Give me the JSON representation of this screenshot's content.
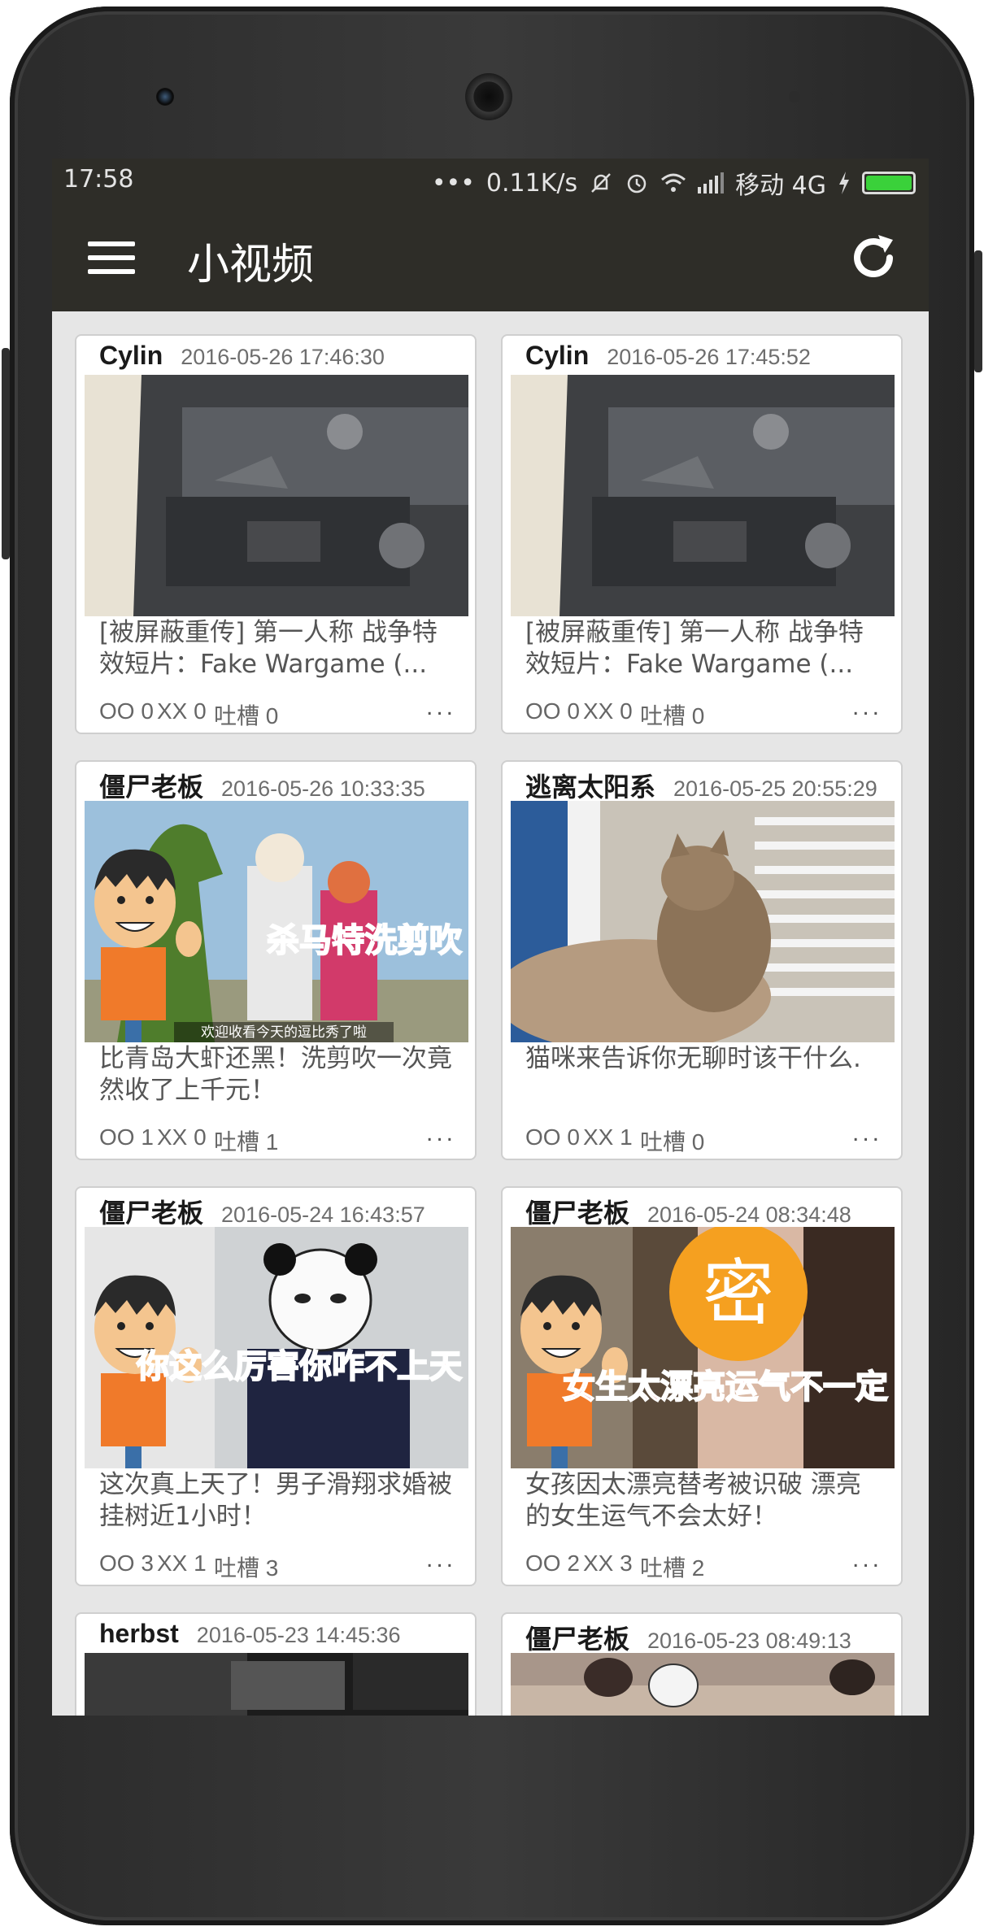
{
  "status": {
    "time": "17:58",
    "dots": "•••",
    "speed": "0.11K/s",
    "carrier": "移动 4G",
    "icons": [
      "mute-icon",
      "alarm-icon",
      "wifi-icon",
      "signal-icon",
      "charging-icon",
      "battery-icon"
    ]
  },
  "appbar": {
    "title": "小视频",
    "menu_icon": "menu-icon",
    "refresh_icon": "refresh-icon"
  },
  "labels": {
    "oo": "OO",
    "xx": "XX",
    "tucao": "吐槽",
    "more": "..."
  },
  "posts": [
    {
      "author": "Cylin",
      "date": "2016-05-26 17:46:30",
      "title": "[被屏蔽重传] 第一人称 战争特效短片：Fake Wargame (...",
      "oo": "OO 0",
      "xx": "XX 0",
      "tucao": "吐槽 0",
      "thumb": "rifle"
    },
    {
      "author": "Cylin",
      "date": "2016-05-26 17:45:52",
      "title": "[被屏蔽重传] 第一人称 战争特效短片：Fake Wargame (...",
      "oo": "OO 0",
      "xx": "XX 0",
      "tucao": "吐槽 0",
      "thumb": "rifle"
    },
    {
      "author": "僵尸老板",
      "date": "2016-05-26 10:33:35",
      "title": "比青岛大虾还黑！洗剪吹一次竟然收了上千元！",
      "oo": "OO 1",
      "xx": "XX 0",
      "tucao": "吐槽 1",
      "thumb": "cartoon-dino",
      "overlay": "杀马特洗剪吹",
      "caption": "欢迎收看今天的逗比秀了啦"
    },
    {
      "author": "逃离太阳系",
      "date": "2016-05-25 20:55:29",
      "title": "猫咪来告诉你无聊时该干什么.",
      "oo": "OO 0",
      "xx": "XX 1",
      "tucao": "吐槽 0",
      "thumb": "cat"
    },
    {
      "author": "僵尸老板",
      "date": "2016-05-24 16:43:57",
      "title": "这次真上天了！男子滑翔求婚被挂树近1小时！",
      "oo": "OO 3",
      "xx": "XX 1",
      "tucao": "吐槽 3",
      "thumb": "cartoon-panda",
      "overlay": "你这么厉害你咋不上天"
    },
    {
      "author": "僵尸老板",
      "date": "2016-05-24 08:34:48",
      "title": "女孩因太漂亮替考被识破 漂亮的女生运气不会太好！",
      "oo": "OO 2",
      "xx": "XX 3",
      "tucao": "吐槽 2",
      "thumb": "cartoon-secret",
      "overlay": "女生太漂亮运气不一定",
      "badge": "密"
    },
    {
      "author": "herbst",
      "date": "2016-05-23 14:45:36",
      "title": "",
      "oo": "",
      "xx": "",
      "tucao": "",
      "thumb": "dark"
    },
    {
      "author": "僵尸老板",
      "date": "2016-05-23 08:49:13",
      "title": "",
      "oo": "",
      "xx": "",
      "tucao": "",
      "thumb": "subway"
    }
  ]
}
